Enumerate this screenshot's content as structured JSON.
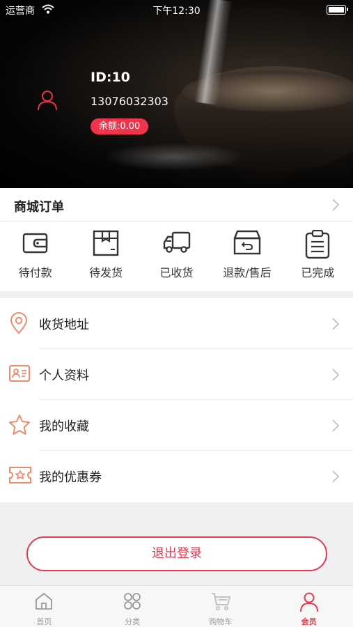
{
  "status_bar": {
    "carrier": "运营商",
    "time": "下午12:30"
  },
  "profile": {
    "id": "ID:10",
    "phone": "13076032303",
    "balance": "余额:0.00"
  },
  "orders": {
    "title": "商城订单",
    "items": [
      {
        "label": "待付款",
        "icon": "wallet-icon"
      },
      {
        "label": "待发货",
        "icon": "package-icon"
      },
      {
        "label": "已收货",
        "icon": "truck-icon"
      },
      {
        "label": "退款/售后",
        "icon": "refund-box-icon"
      },
      {
        "label": "已完成",
        "icon": "clipboard-icon"
      }
    ]
  },
  "menu": {
    "items": [
      {
        "label": "收货地址",
        "icon": "location-pin-icon"
      },
      {
        "label": "个人资料",
        "icon": "id-card-icon"
      },
      {
        "label": "我的收藏",
        "icon": "star-icon"
      },
      {
        "label": "我的优惠券",
        "icon": "coupon-icon"
      }
    ]
  },
  "logout_label": "退出登录",
  "tab_bar": {
    "items": [
      {
        "label": "首页",
        "icon": "home-icon"
      },
      {
        "label": "分类",
        "icon": "grid-icon"
      },
      {
        "label": "购物车",
        "icon": "cart-icon"
      },
      {
        "label": "会员",
        "icon": "person-icon"
      }
    ],
    "active_index": 3
  },
  "colors": {
    "accent": "#e5394f",
    "badge": "#f0344b",
    "menu_icon": "#f08a6c"
  }
}
